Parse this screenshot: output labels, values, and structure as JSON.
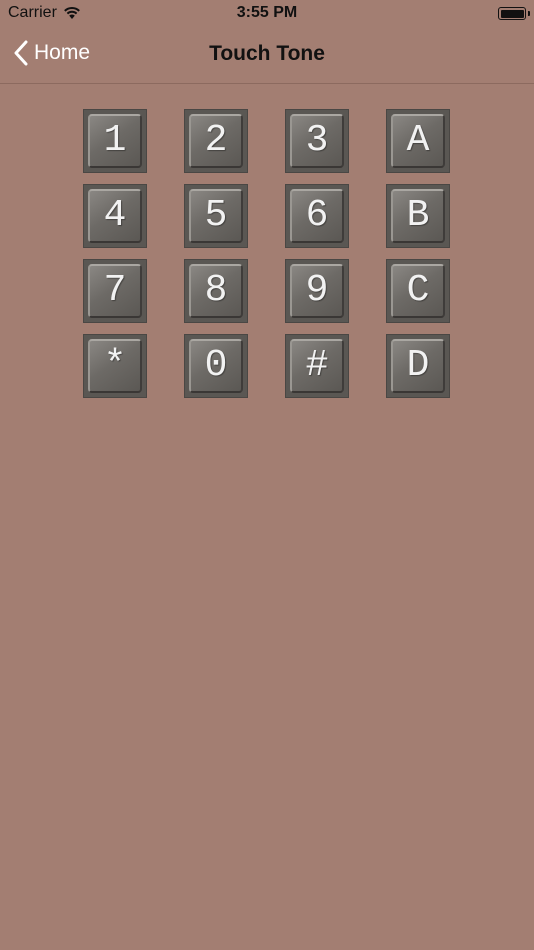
{
  "status_bar": {
    "carrier": "Carrier",
    "time": "3:55 PM",
    "wifi_icon": "wifi-icon",
    "battery_icon": "battery-full-icon"
  },
  "nav_bar": {
    "back_label": "Home",
    "back_icon": "chevron-left-icon",
    "title": "Touch Tone"
  },
  "keypad": {
    "keys": [
      "1",
      "2",
      "3",
      "A",
      "4",
      "5",
      "6",
      "B",
      "7",
      "8",
      "9",
      "C",
      "*",
      "0",
      "#",
      "D"
    ]
  },
  "colors": {
    "background": "#a37e72",
    "key_base": "#5a5753",
    "key_face": "#6d6a66",
    "key_text": "#f2f2f2",
    "nav_back": "#ffffff",
    "nav_title": "#111111"
  }
}
